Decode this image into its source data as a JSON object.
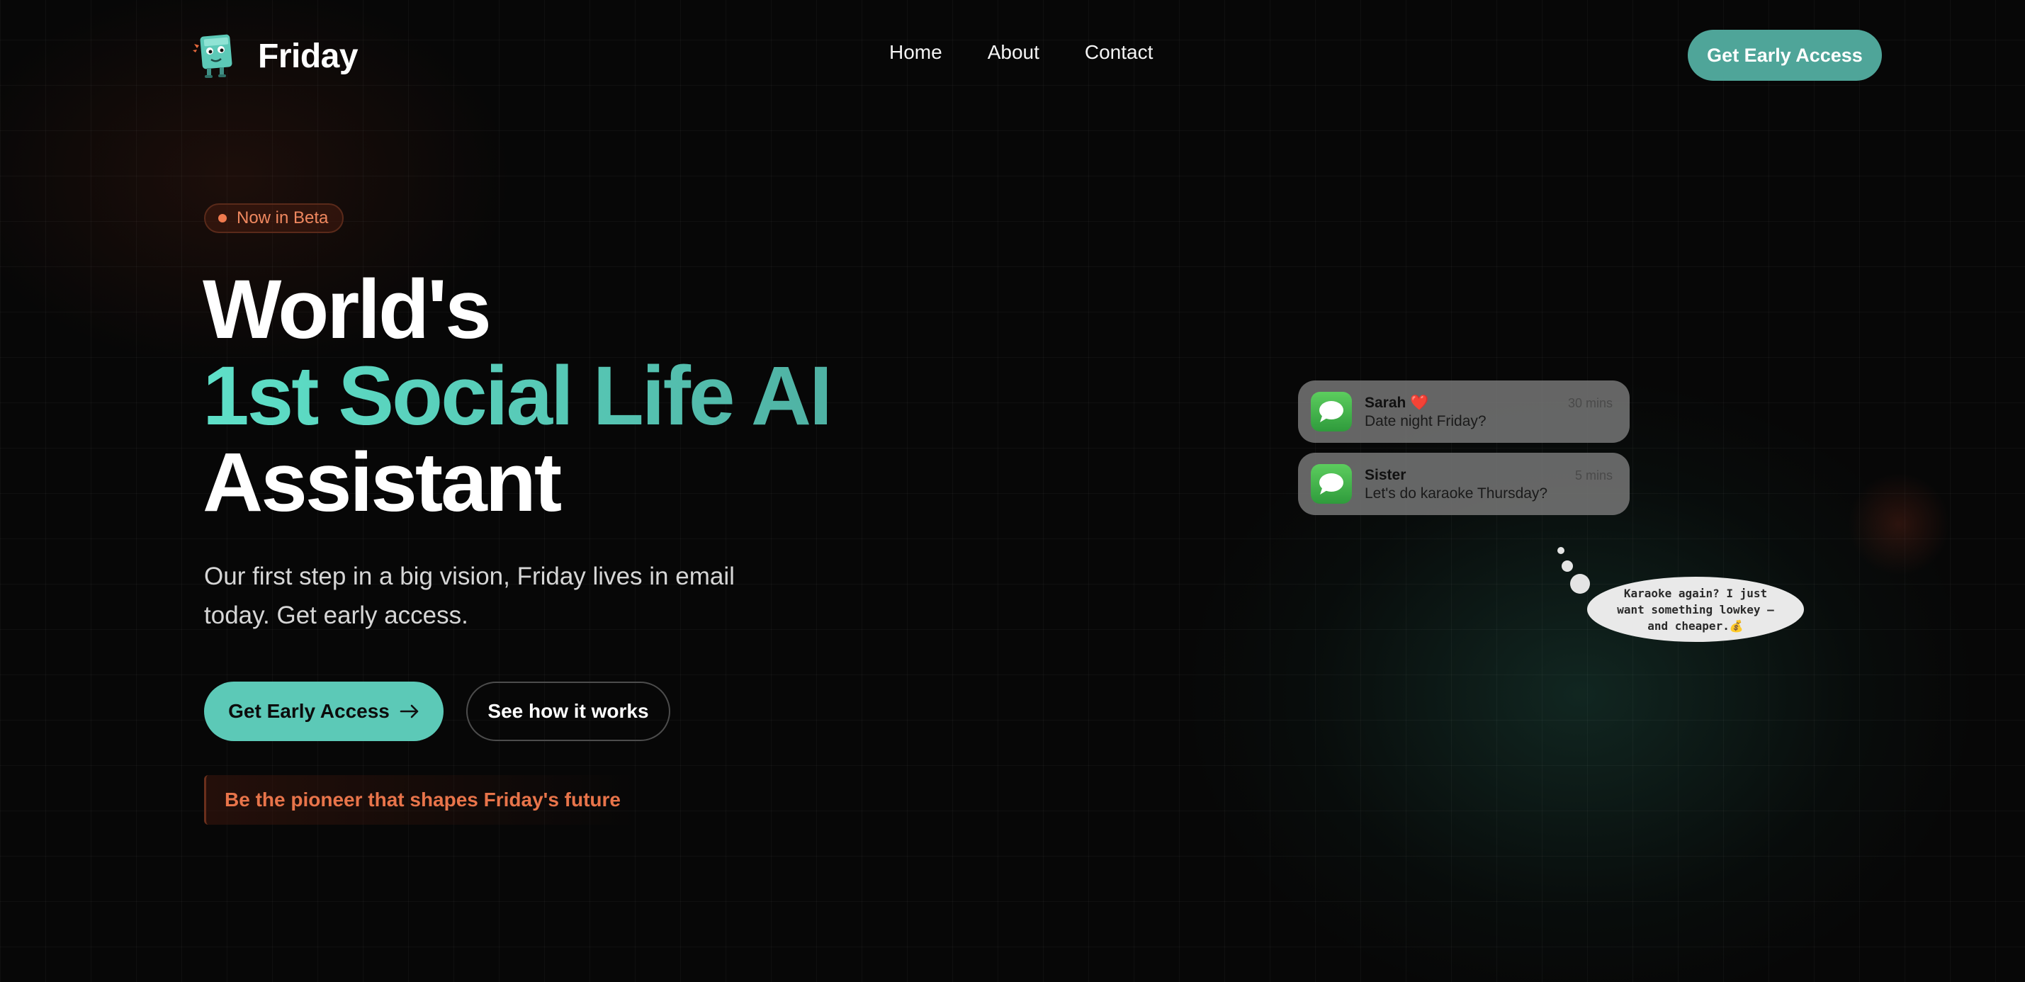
{
  "brand": {
    "name": "Friday",
    "logo_icon": "friday-mascot-icon"
  },
  "nav": {
    "links": [
      {
        "label": "Home"
      },
      {
        "label": "About"
      },
      {
        "label": "Contact"
      }
    ],
    "cta_label": "Get Early Access"
  },
  "hero": {
    "badge": "Now in Beta",
    "headline": {
      "line1": "World's",
      "line2": "1st Social Life AI",
      "line3": "Assistant"
    },
    "subtext": "Our first step in a big vision, Friday lives in email today. Get early access.",
    "primary_cta": "Get Early Access",
    "primary_cta_icon": "arrow-right-icon",
    "secondary_cta": "See how it works",
    "pioneer_text": "Be the pioneer that shapes Friday's future"
  },
  "notifications": [
    {
      "name": "Sarah ❤️",
      "message": "Date night Friday?",
      "time": "30 mins",
      "icon": "messages-app-icon"
    },
    {
      "name": "Sister",
      "message": "Let's do karaoke Thursday?",
      "time": "5 mins",
      "icon": "messages-app-icon"
    }
  ],
  "thought": {
    "text": "Karaoke again? I just want something lowkey — and cheaper.💰"
  },
  "colors": {
    "accent_teal": "#5cc9b7",
    "nav_cta": "#4fa599",
    "beta_orange": "#f07a4e",
    "pioneer_orange": "#e8744a",
    "background": "#070707"
  }
}
